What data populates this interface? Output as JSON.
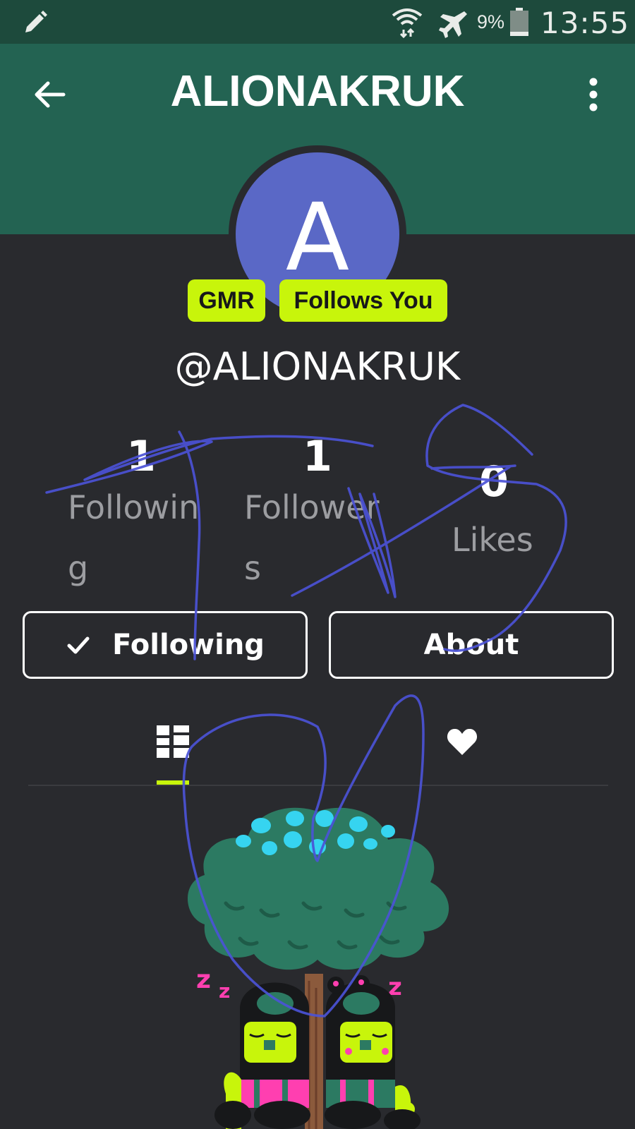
{
  "status_bar": {
    "battery_percent": "9%",
    "time": "13:55",
    "icons": [
      "pencil-icon",
      "wifi-icon",
      "airplane-mode-icon",
      "battery-icon"
    ]
  },
  "header": {
    "title": "ALIONAKRUK",
    "back_icon": "arrow-left-icon",
    "menu_icon": "more-vertical-icon",
    "background_color": "#236352"
  },
  "profile": {
    "avatar_letter": "A",
    "avatar_color": "#5a68c6",
    "badges": [
      "GMR",
      "Follows You"
    ],
    "badge_color": "#c8f50b",
    "handle": "@ALIONAKRUK"
  },
  "stats": [
    {
      "value": "1",
      "label": "Following"
    },
    {
      "value": "1",
      "label": "Followers"
    },
    {
      "value": "0",
      "label": "Likes"
    }
  ],
  "actions": {
    "following_label": "Following",
    "about_label": "About"
  },
  "tabs": [
    {
      "icon": "grid-icon",
      "selected": true
    },
    {
      "icon": "heart-icon",
      "selected": false
    }
  ],
  "scribble_color": "#4b52d6"
}
